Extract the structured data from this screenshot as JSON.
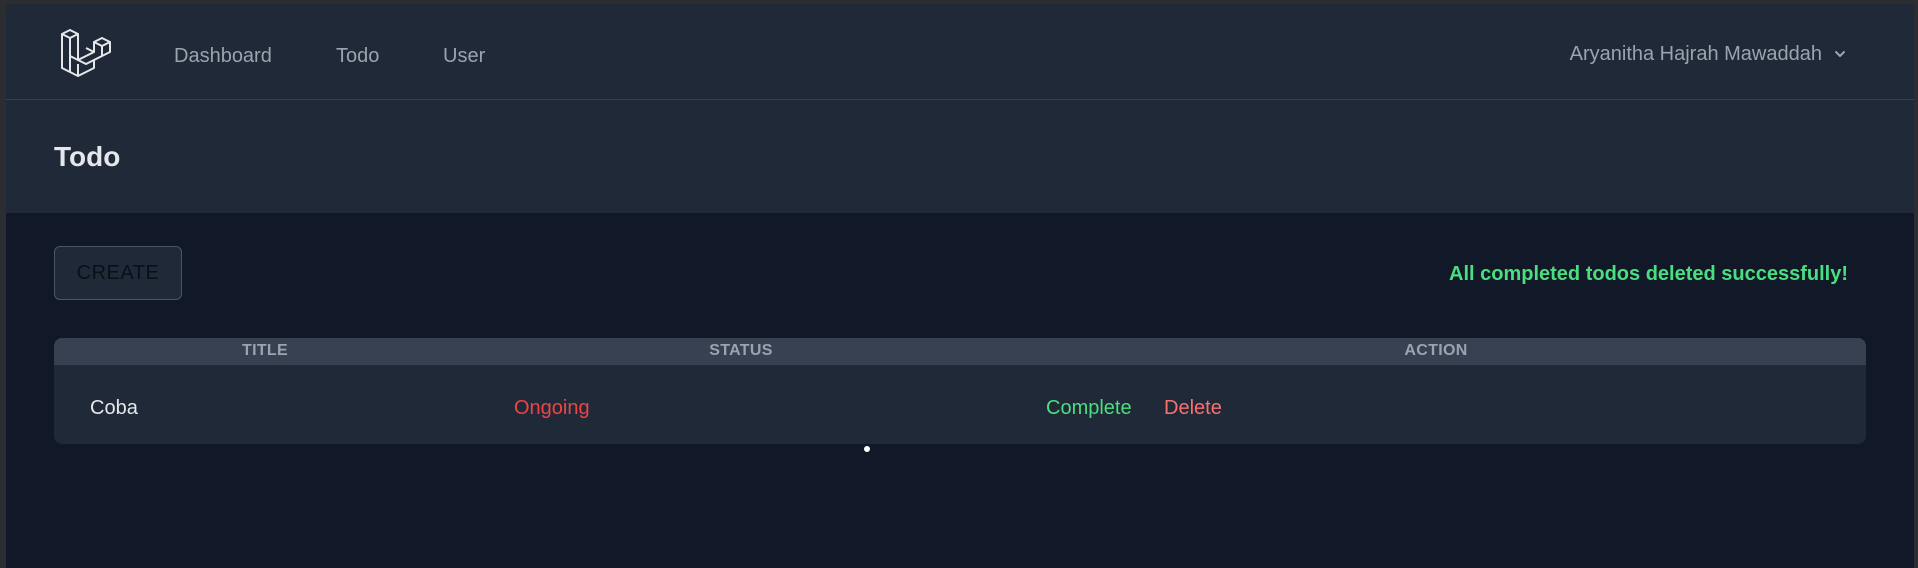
{
  "nav": {
    "logo_icon": "laravel-logo-icon",
    "links": [
      "Dashboard",
      "Todo",
      "User"
    ],
    "user_name": "Aryanitha Hajrah Mawaddah",
    "user_menu_icon": "chevron-down-icon"
  },
  "header": {
    "title": "Todo"
  },
  "main": {
    "create_label": "CREATE",
    "flash_message": "All completed todos deleted successfully!",
    "table": {
      "columns": [
        "TITLE",
        "STATUS",
        "ACTION"
      ],
      "rows": [
        {
          "title": "Coba",
          "status": "Ongoing",
          "actions": [
            "Complete",
            "Delete"
          ]
        }
      ]
    }
  },
  "colors": {
    "page_bg": "#111827",
    "panel_bg": "#1f2937",
    "table_head_bg": "#374151",
    "success": "#4ade80",
    "status_ongoing": "#ef4444",
    "danger": "#f87171"
  }
}
